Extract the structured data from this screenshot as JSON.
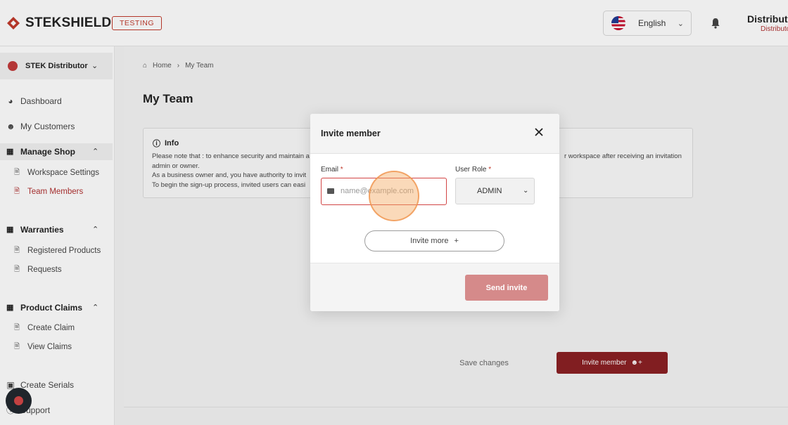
{
  "header": {
    "logo_text": "STEKSHIELD",
    "env_badge": "TESTING",
    "language": "English",
    "user_name": "Distributor",
    "user_role": "Distributor"
  },
  "sidebar": {
    "workspace": "STEK Distributor",
    "top_items": [
      {
        "label": "Dashboard",
        "icon": "pie-chart-icon"
      },
      {
        "label": "My Customers",
        "icon": "users-icon"
      }
    ],
    "sections": [
      {
        "label": "Manage Shop",
        "items": [
          "Workspace Settings",
          "Team Members"
        ],
        "active_item": "Team Members"
      },
      {
        "label": "Warranties",
        "items": [
          "Registered Products",
          "Requests"
        ]
      },
      {
        "label": "Product Claims",
        "items": [
          "Create Claim",
          "View Claims"
        ]
      }
    ],
    "bottom_items": [
      {
        "label": "Create Serials",
        "icon": "scan-icon"
      },
      {
        "label": "Support",
        "icon": "help-icon"
      }
    ]
  },
  "breadcrumb": {
    "home": "Home",
    "current": "My Team"
  },
  "page": {
    "title": "My Team",
    "info_title": "Info",
    "info_lines": [
      "Please note that : to enhance security and maintain a",
      "admin or owner.",
      "As a business owner and, you have authority to invit",
      "To begin the sign-up process, invited users can easi"
    ],
    "info_right": "r workspace after receiving an invitation",
    "save_changes": "Save changes",
    "invite_member": "Invite member"
  },
  "modal": {
    "title": "Invite member",
    "email_label": "Email",
    "email_placeholder": "name@example.com",
    "role_label": "User Role",
    "role_value": "ADMIN",
    "invite_more": "Invite more",
    "send_invite": "Send invite",
    "required_mark": "*"
  },
  "colors": {
    "brand": "#8a1f22",
    "accent_red": "#c0392b",
    "send_disabled": "#d58a8a"
  }
}
